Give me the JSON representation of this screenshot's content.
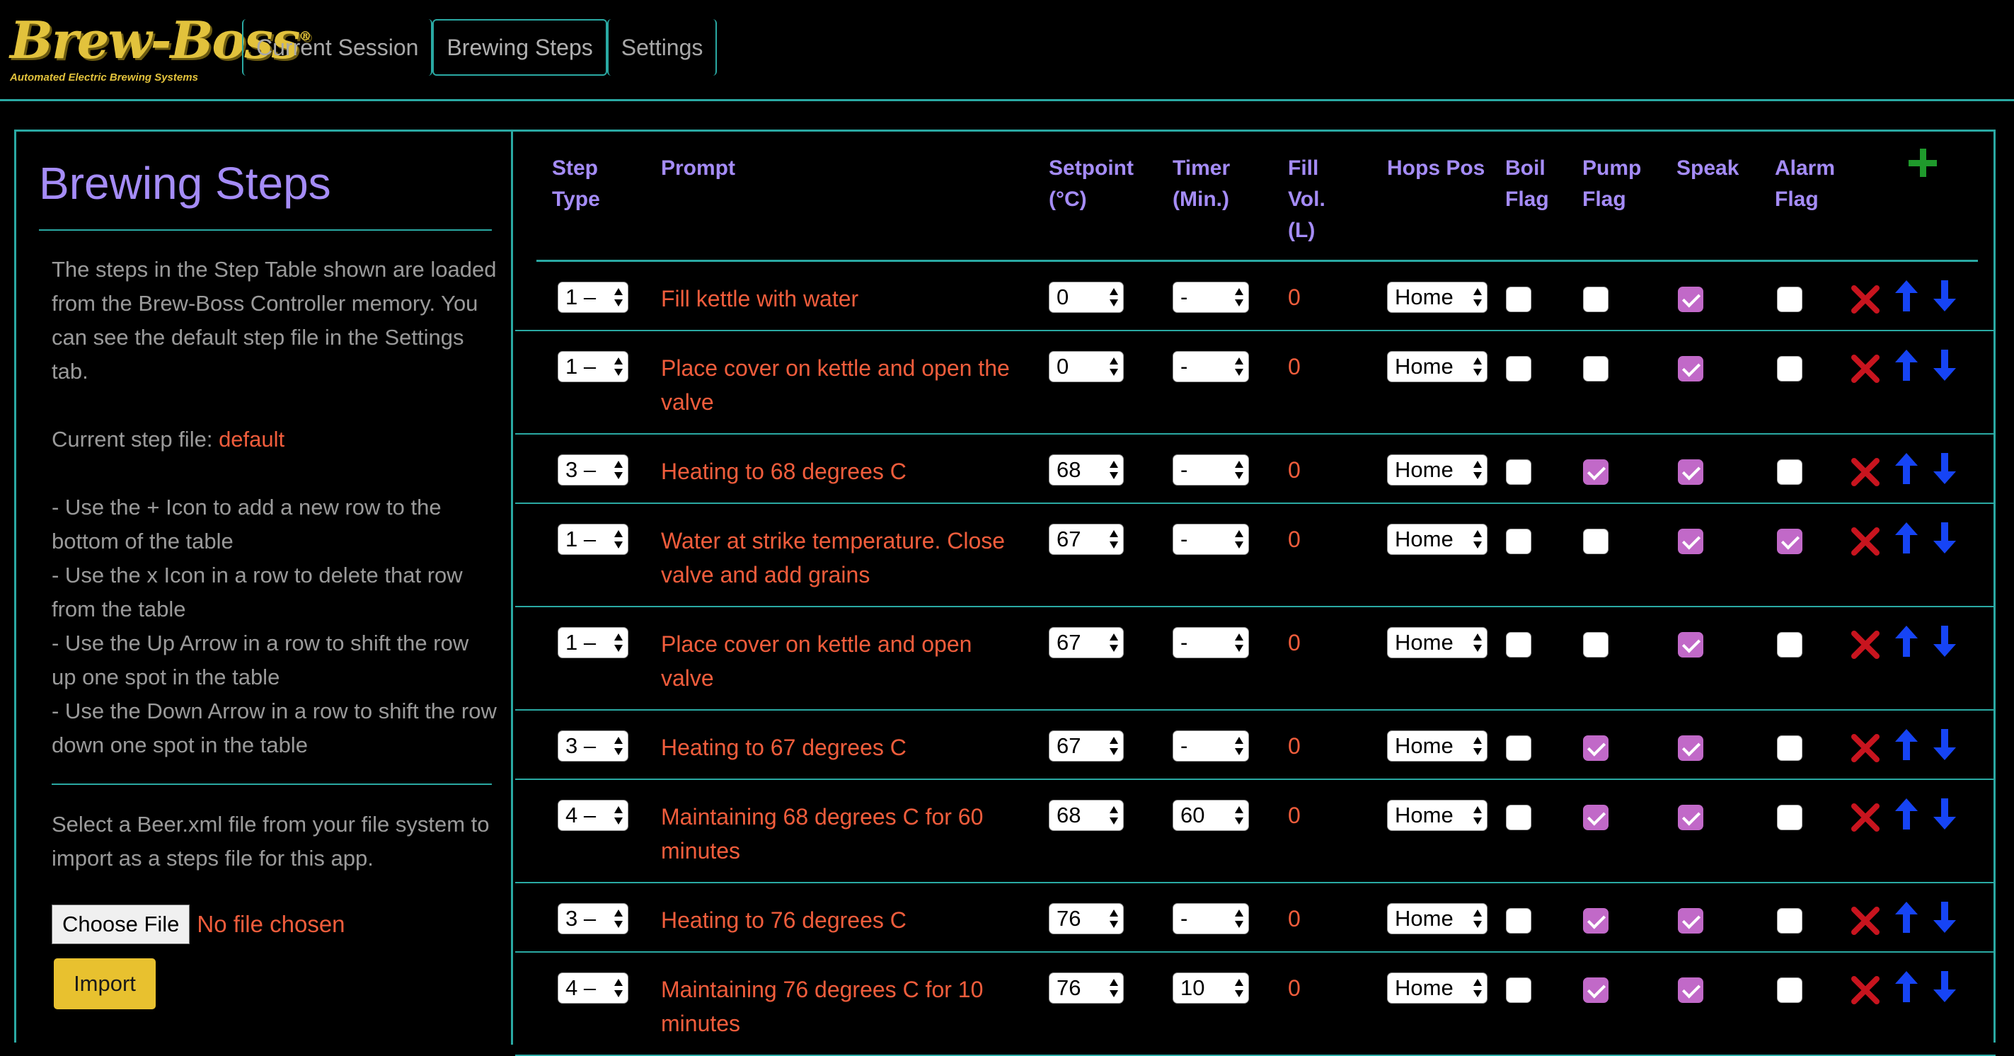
{
  "logo": {
    "word": "Brew-Boss",
    "reg": "®",
    "tagline": "Automated Electric Brewing Systems"
  },
  "nav": {
    "tabs": [
      "Current Session",
      "Brewing Steps",
      "Settings"
    ],
    "active": "Brewing Steps"
  },
  "sidebar": {
    "title": "Brewing Steps",
    "intro": "The steps in the Step Table shown are loaded from the Brew-Boss Controller memory. You can see the default step file in the Settings tab.",
    "current_file_label": "Current step file:",
    "current_file": "default",
    "help": [
      "- Use the + Icon to add a new row to the bottom of the table",
      "- Use the x Icon in a row to delete that row from the table",
      "- Use the Up Arrow in a row to shift the row up one spot in the table",
      "- Use the Down Arrow in a row to shift the row down one spot in the table"
    ],
    "import_text": "Select a Beer.xml file from your file system to import as a steps file for this app.",
    "choose_file": "Choose File",
    "no_file": "No file chosen",
    "import_button": "Import"
  },
  "table": {
    "headers": {
      "step_type": [
        "Step",
        "Type"
      ],
      "prompt": [
        "Prompt"
      ],
      "setpoint": [
        "Setpoint",
        "(°C)"
      ],
      "timer": [
        "Timer",
        "(Min.)"
      ],
      "fill": [
        "Fill",
        "Vol.",
        "(L)"
      ],
      "hops": [
        "Hops Pos"
      ],
      "boil": [
        "Boil",
        "Flag"
      ],
      "pump": [
        "Pump",
        "Flag"
      ],
      "speak": [
        "Speak"
      ],
      "alarm": [
        "Alarm",
        "Flag"
      ]
    },
    "rows": [
      {
        "step": "1 –",
        "prompt": "Fill kettle with water",
        "setpoint": "0",
        "timer": "-",
        "fill": "0",
        "hops": "Home",
        "boil": false,
        "pump": false,
        "speak": true,
        "alarm": false
      },
      {
        "step": "1 –",
        "prompt": "Place cover on kettle and open the valve",
        "setpoint": "0",
        "timer": "-",
        "fill": "0",
        "hops": "Home",
        "boil": false,
        "pump": false,
        "speak": true,
        "alarm": false
      },
      {
        "step": "3 –",
        "prompt": "Heating to 68 degrees C",
        "setpoint": "68",
        "timer": "-",
        "fill": "0",
        "hops": "Home",
        "boil": false,
        "pump": true,
        "speak": true,
        "alarm": false
      },
      {
        "step": "1 –",
        "prompt": "Water at strike temperature. Close valve and add grains",
        "setpoint": "67",
        "timer": "-",
        "fill": "0",
        "hops": "Home",
        "boil": false,
        "pump": false,
        "speak": true,
        "alarm": true
      },
      {
        "step": "1 –",
        "prompt": "Place cover on kettle and open valve",
        "setpoint": "67",
        "timer": "-",
        "fill": "0",
        "hops": "Home",
        "boil": false,
        "pump": false,
        "speak": true,
        "alarm": false
      },
      {
        "step": "3 –",
        "prompt": "Heating to 67 degrees C",
        "setpoint": "67",
        "timer": "-",
        "fill": "0",
        "hops": "Home",
        "boil": false,
        "pump": true,
        "speak": true,
        "alarm": false
      },
      {
        "step": "4 –",
        "prompt": "Maintaining 68 degrees C for 60 minutes",
        "setpoint": "68",
        "timer": "60",
        "fill": "0",
        "hops": "Home",
        "boil": false,
        "pump": true,
        "speak": true,
        "alarm": false
      },
      {
        "step": "3 –",
        "prompt": "Heating to 76 degrees C",
        "setpoint": "76",
        "timer": "-",
        "fill": "0",
        "hops": "Home",
        "boil": false,
        "pump": true,
        "speak": true,
        "alarm": false
      },
      {
        "step": "4 –",
        "prompt": "Maintaining 76 degrees C for 10 minutes",
        "setpoint": "76",
        "timer": "10",
        "fill": "0",
        "hops": "Home",
        "boil": false,
        "pump": true,
        "speak": true,
        "alarm": false
      }
    ]
  },
  "icons": {
    "add": "plus-icon",
    "delete": "x-icon",
    "up": "arrow-up-icon",
    "down": "arrow-down-icon"
  },
  "colors": {
    "accent_teal": "#2aa9a3",
    "heading_purple": "#a58cf7",
    "prompt_red": "#f15d3c",
    "check_purple": "#c169c8",
    "add_green": "#1f9a2c",
    "delete_red": "#c8141e",
    "arrow_blue": "#1644f5",
    "import_yellow": "#e8c12f"
  }
}
